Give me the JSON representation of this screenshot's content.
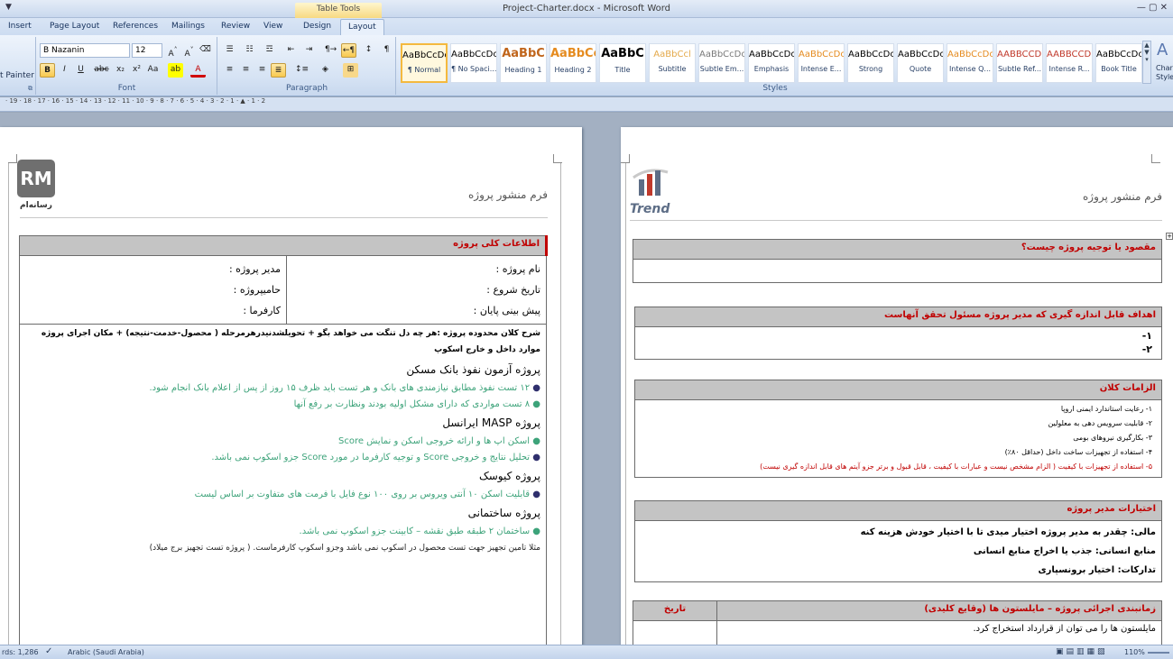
{
  "window": {
    "title": "Project-Charter.docx - Microsoft Word",
    "quick_access": "▼",
    "context_tab_group": "Table Tools"
  },
  "tabs": [
    "Insert",
    "Page Layout",
    "References",
    "Mailings",
    "Review",
    "View",
    "Design",
    "Layout"
  ],
  "clipboard": {
    "format_painter": "t Painter"
  },
  "font": {
    "name": "B Nazanin",
    "size": "12",
    "group_label": "Font"
  },
  "paragraph": {
    "group_label": "Paragraph"
  },
  "styles": {
    "group_label": "Styles",
    "change_label_1": "Char",
    "change_label_2": "Style",
    "items": [
      {
        "sample": "AaBbCcDc",
        "name": "¶ Normal",
        "color": "#000000"
      },
      {
        "sample": "AaBbCcDc",
        "name": "¶ No Spaci...",
        "color": "#000000"
      },
      {
        "sample": "AaBbC",
        "name": "Heading 1",
        "color": "#c0651b"
      },
      {
        "sample": "AaBbCc",
        "name": "Heading 2",
        "color": "#e58b1f"
      },
      {
        "sample": "AaBbC",
        "name": "Title",
        "color": "#000000"
      },
      {
        "sample": "AaBbCcl",
        "name": "Subtitle",
        "color": "#e4a94a"
      },
      {
        "sample": "AaBbCcDc",
        "name": "Subtle Em...",
        "color": "#7a7a7a"
      },
      {
        "sample": "AaBbCcDc",
        "name": "Emphasis",
        "color": "#000000"
      },
      {
        "sample": "AaBbCcDc",
        "name": "Intense E...",
        "color": "#e58b1f"
      },
      {
        "sample": "AaBbCcDc",
        "name": "Strong",
        "color": "#000000"
      },
      {
        "sample": "AaBbCcDc",
        "name": "Quote",
        "color": "#000000"
      },
      {
        "sample": "AaBbCcDc",
        "name": "Intense Q...",
        "color": "#e58b1f"
      },
      {
        "sample": "AABBCCDE",
        "name": "Subtle Ref...",
        "color": "#c0392b"
      },
      {
        "sample": "AABBCCDE",
        "name": "Intense R...",
        "color": "#c0392b"
      },
      {
        "sample": "AaBbCcDc",
        "name": "Book Title",
        "color": "#000000"
      }
    ]
  },
  "ruler": "· 19 · 18 · 17 · 16 · 15 · 14 · 13 · 12 · 11 · 10 · 9 · 8 · 7 · 6 · 5 · 4 · 3 · 2 · 1 · ▲ · 1 · 2",
  "left_page": {
    "logo_text": "رسانه‌ام",
    "logo_letters": "RM",
    "header": "فرم منشور پروژه",
    "general_title": "اطلاعات کلی  پروژه",
    "fields": {
      "project_name": "نام پروژه :",
      "project_manager": "مدیر پروژه :",
      "start_date": "تاریخ شروع :",
      "sponsor": "حامیپروژه :",
      "end_forecast": "پیش بینی پایان :",
      "employer": "کارفرما :"
    },
    "scope_title": "شرح کلان محدوده پروژه :هر چه دل تنگت می خواهد بگو + تحویلشدنیدرهرمرحله ( محصول-خدمت-نتیجه) + مکان اجرای پروژه",
    "scope_sub": "موارد داخل و خارج اسکوپ",
    "projects": [
      {
        "title": "پروژه آزمون نفوذ بانک مسکن",
        "bullets": [
          "۱۲ تست نفوذ مطابق نیازمندی های بانک و هر تست باید ظرف ۱۵ روز از پس از اعلام بانک انجام شود.",
          "۸ تست مواردی که دارای مشکل اولیه بودند ونظارت بر رفع آنها"
        ]
      },
      {
        "title": "پروژه MASP ایرانسل",
        "bullets": [
          "اسکن اپ ها و ارائه خروجی اسکن و نمایش Score",
          "تحلیل نتایج و خروجی Score و توجیه کارفرما در مورد Score جزو اسکوپ نمی باشد."
        ]
      },
      {
        "title": "پروژه کیوسک",
        "bullets": [
          "قابلیت اسکن ۱۰ آنتی ویروس بر روی ۱۰۰ نوع فایل با فرمت های متفاوت بر اساس لیست"
        ]
      },
      {
        "title": "پروژه ساختمانی",
        "bullets": [
          "ساختمان ۲ طبقه طبق نقشه – کابینت جزو اسکوپ نمی باشد."
        ]
      }
    ],
    "example": "مثلا تامین تجهیز جهت تست محصول در اسکوپ نمی باشد وجزو اسکوپ کارفرماست. ( پروژه تست تجهیز برج میلاد)"
  },
  "right_page": {
    "logo_text": "Trend",
    "header": "فرم منشور پروژه",
    "purpose_title": "مقصود یا توجیه پروژه چیست؟",
    "goals_title": "اهداف قابل اندازه گیری که مدیر پروژه مسئول تحقق آنهاست",
    "goals": [
      "۱-",
      "۲-"
    ],
    "requirements_title": "الزامات کلان",
    "requirements": [
      "۱-    رعایت استاندارد ایمنی اروپا",
      "۲-    قابلیت سرویس دهی به معلولین",
      "۳-    بکارگیری نیروهای بومی",
      "۴-    استفاده از تجهیزات ساخت داخل (حداقل ۸۰٪)",
      "۵-    استفاده از تجهیزات با کیفیت ( الزام مشخص نیست و عبارات با کیفیت ، قابل قبول و برتر جزو آیتم های قابل اندازه گیری نیست)"
    ],
    "authority_title": "اختیارات مدیر پروژه",
    "authority": [
      "مالی: چقدر به مدیر پروژه اختیار میدی تا با اختیار خودش هزینه کنه",
      "منابع انسانی: جذب یا اخراج منابع انسانی",
      "تدارکات: اختیار برونسپاری"
    ],
    "schedule_title": "زمانبندی اجرائی پروژه – مایلستون ها (وقایع کلیدی)",
    "schedule_date": "تاریخ",
    "schedule_note": "مایلستون ها را می توان از قرارداد استخراج کرد."
  },
  "status": {
    "words": "rds: 1,286",
    "language": "Arabic (Saudi Arabia)",
    "zoom": "110%"
  },
  "colors": {
    "accent_red": "#c00000",
    "bullet_green": "#3da37a",
    "header_gray": "#c4c4c4"
  }
}
